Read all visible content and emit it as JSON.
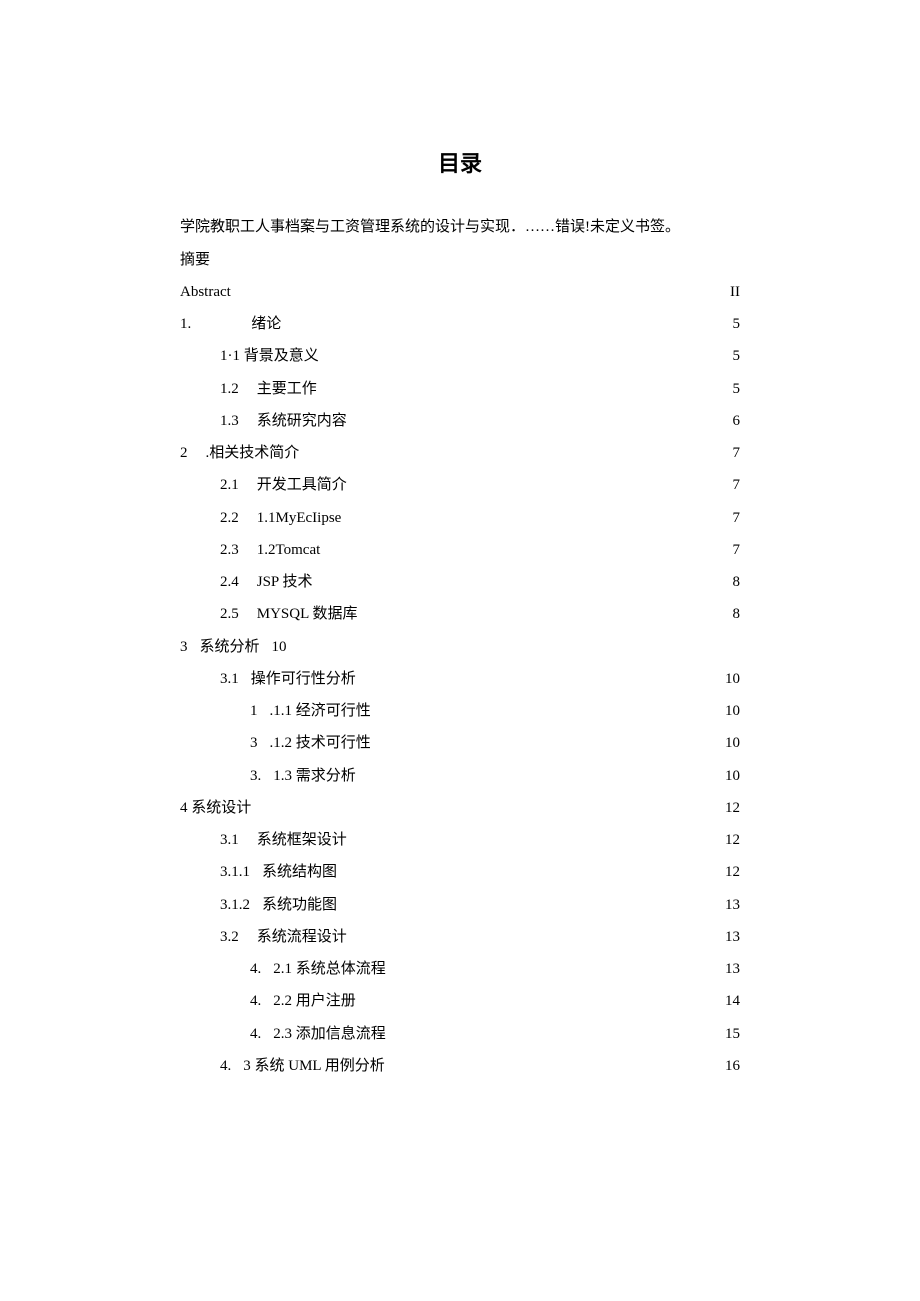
{
  "title": "目录",
  "toc": [
    {
      "indent": "indent-0",
      "label": "学院教职工人事档案与工资管理系统的设计与实现．……错误!未定义书签。",
      "leader": "",
      "page": ""
    },
    {
      "indent": "indent-0",
      "label": "摘要",
      "leader": "dotted-wide",
      "page": ""
    },
    {
      "indent": "indent-0",
      "label": "Abstract",
      "leader": "dotted-tight",
      "page": "II"
    },
    {
      "indent": "indent-0",
      "label": "1.",
      "spacer": 60,
      "label2": "绪论",
      "leader": "dotted-wide",
      "page": "5"
    },
    {
      "indent": "indent-1",
      "label": "1·1 背景及意义",
      "leader": "dotted-wide",
      "page": "5"
    },
    {
      "indent": "indent-1",
      "label": "1.2",
      "spacer": 18,
      "label2": "主要工作",
      "leader": "dotted-wide",
      "page": "5"
    },
    {
      "indent": "indent-1",
      "label": "1.3",
      "spacer": 18,
      "label2": "系统研究内容",
      "leader": "dotted-wide",
      "page": "6"
    },
    {
      "indent": "indent-0",
      "label": "2",
      "spacer": 18,
      "label2": ".相关技术简介",
      "leader": "dotted-wide",
      "page": "7"
    },
    {
      "indent": "indent-1",
      "label": "2.1",
      "spacer": 18,
      "label2": "开发工具简介",
      "leader": "dotted-wide",
      "page": "7"
    },
    {
      "indent": "indent-1",
      "label": "2.2",
      "spacer": 18,
      "label2": "1.1MyEcIipse",
      "leader": "dotted-tight",
      "page": "7"
    },
    {
      "indent": "indent-1",
      "label": "2.3",
      "spacer": 18,
      "label2": "1.2Tomcat",
      "leader": "dotted-tight",
      "page": "7"
    },
    {
      "indent": "indent-1",
      "label": "2.4",
      "spacer": 18,
      "label2": "JSP 技术",
      "leader": "dotted-wide",
      "page": "8"
    },
    {
      "indent": "indent-1",
      "label": "2.5",
      "spacer": 18,
      "label2": "MYSQL 数据库",
      "leader": "dotted-wide",
      "page": "8"
    },
    {
      "indent": "indent-0",
      "label": "3",
      "spacer": 12,
      "label2": "系统分析",
      "spacer2": 12,
      "label3": "10",
      "leader": "",
      "page": ""
    },
    {
      "indent": "indent-1",
      "label": "3.1",
      "spacer": 12,
      "label2": "操作可行性分析",
      "leader": "dotted-wide",
      "page": "10"
    },
    {
      "indent": "indent-2",
      "label": "1",
      "spacer": 12,
      "label2": ".1.1 经济可行性",
      "leader": "dotted-wide",
      "page": "10"
    },
    {
      "indent": "indent-2",
      "label": "3",
      "spacer": 12,
      "label2": ".1.2 技术可行性",
      "leader": "dotted-wide",
      "page": "10"
    },
    {
      "indent": "indent-2",
      "label": "3.",
      "spacer": 12,
      "label2": "1.3 需求分析",
      "leader": "dotted-wide",
      "page": "10"
    },
    {
      "indent": "indent-0",
      "label": "4 系统设计",
      "leader": "dotted-wide",
      "page": "12"
    },
    {
      "indent": "indent-1",
      "label": "3.1",
      "spacer": 18,
      "label2": "系统框架设计",
      "leader": "dotted-wide",
      "page": "12"
    },
    {
      "indent": "indent-1",
      "label": "3.1.1",
      "spacer": 12,
      "label2": "系统结构图",
      "leader": "dotted-wide",
      "page": "12"
    },
    {
      "indent": "indent-1",
      "label": "3.1.2",
      "spacer": 12,
      "label2": "系统功能图",
      "leader": "dotted-wide",
      "page": "13"
    },
    {
      "indent": "indent-1",
      "label": "3.2",
      "spacer": 18,
      "label2": "系统流程设计",
      "leader": "dotted-wide",
      "page": "13"
    },
    {
      "indent": "indent-2",
      "label": "4.",
      "spacer": 12,
      "label2": "2.1 系统总体流程",
      "leader": "dotted-wide",
      "page": "13"
    },
    {
      "indent": "indent-2",
      "label": "4.",
      "spacer": 12,
      "label2": "2.2 用户注册",
      "leader": "dotted-wide",
      "page": "14"
    },
    {
      "indent": "indent-2",
      "label": "4.",
      "spacer": 12,
      "label2": "2.3 添加信息流程",
      "leader": "dotted-wide",
      "page": "15"
    },
    {
      "indent": "indent-1",
      "label": "4.",
      "spacer": 12,
      "label2": "3 系统 UML 用例分析",
      "leader": "dotted-wide",
      "page": "16"
    }
  ]
}
